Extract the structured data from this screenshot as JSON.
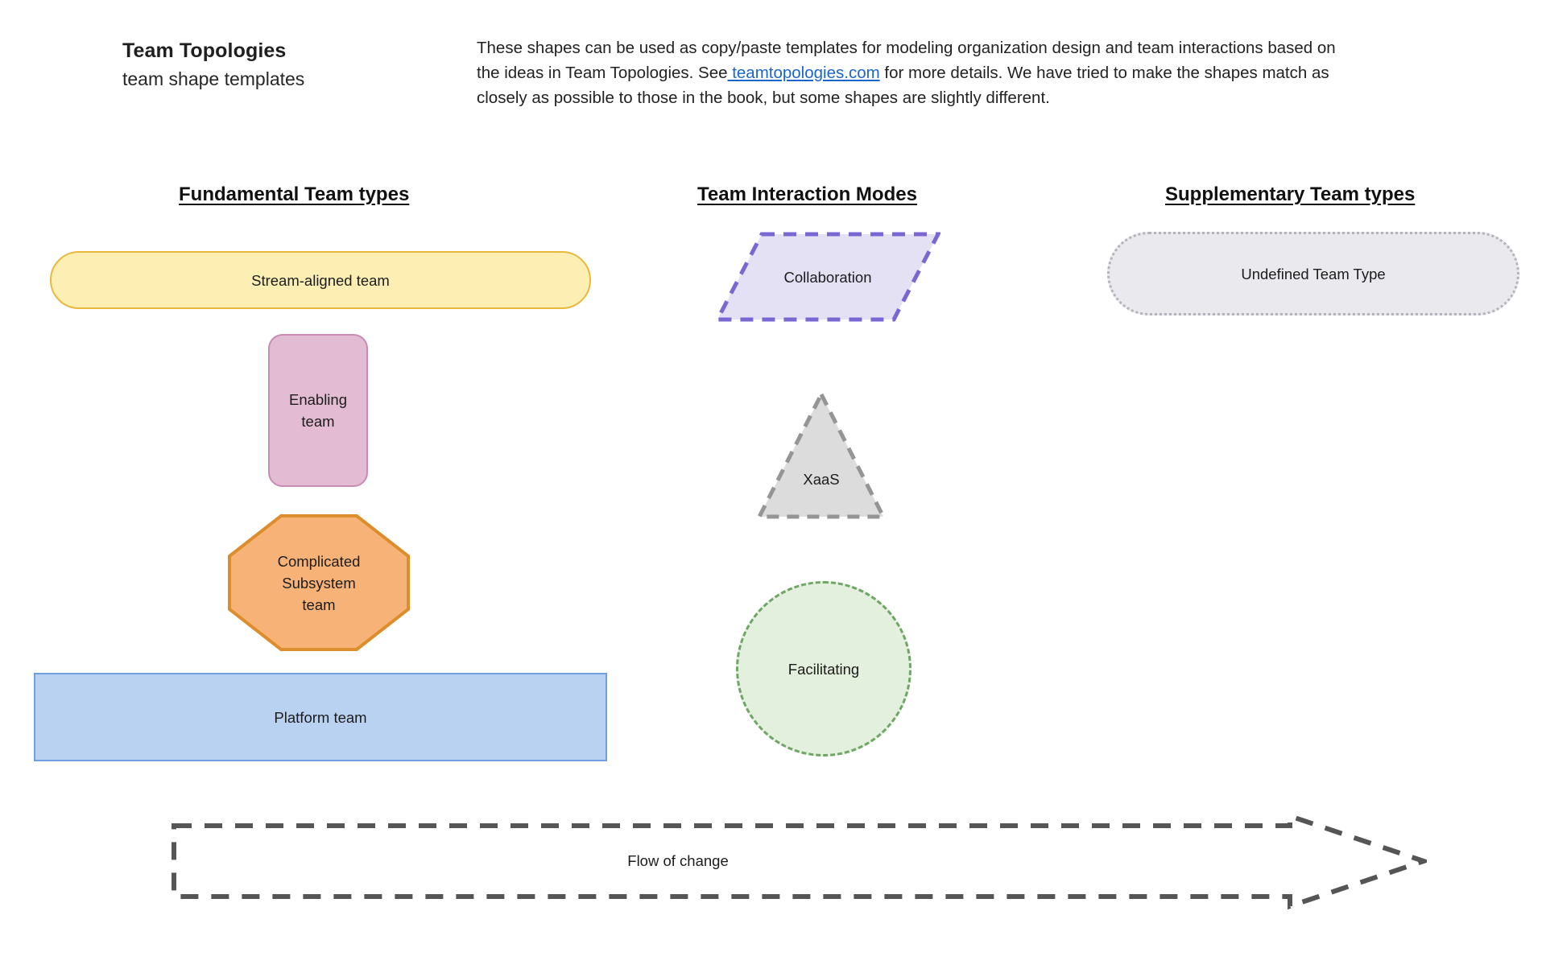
{
  "header": {
    "title": "Team Topologies",
    "subtitle": "team shape templates",
    "description_part1": "These shapes can be used as copy/paste templates for modeling organization design and team interactions based on the ideas in Team Topologies. See",
    "description_link": " teamtopologies.com",
    "description_part2": " for more details. We have tried to make the shapes match as closely as possible to those in the book, but some shapes are slightly different."
  },
  "columns": {
    "fundamental": "Fundamental Team types",
    "interaction": "Team Interaction Modes",
    "supplementary": "Supplementary Team types"
  },
  "shapes": {
    "stream_aligned": {
      "label": "Stream-aligned team",
      "fill": "#fdeeb3",
      "stroke": "#e8b93b",
      "form": "rounded-rectangle"
    },
    "enabling": {
      "label": "Enabling\nteam",
      "fill": "#e3bcd4",
      "stroke": "#c98bb4",
      "form": "rounded-rectangle-tall"
    },
    "complicated_subsystem": {
      "label": "Complicated\nSubsystem\nteam",
      "fill": "#f7b377",
      "stroke": "#dd8d2c",
      "form": "octagon"
    },
    "platform": {
      "label": "Platform team",
      "fill": "#bad2f2",
      "stroke": "#6f9fe0",
      "form": "rectangle"
    },
    "collaboration": {
      "label": "Collaboration",
      "fill": "#e4e1f5",
      "stroke": "#7a67d4",
      "form": "parallelogram-dashed"
    },
    "xaas": {
      "label": "XaaS",
      "fill": "#dcdcdc",
      "stroke": "#959595",
      "form": "triangle-dashed"
    },
    "facilitating": {
      "label": "Facilitating",
      "fill": "#e2f0dd",
      "stroke": "#6fa565",
      "form": "circle-dashed"
    },
    "undefined_team_type": {
      "label": "Undefined Team Type",
      "fill": "#e9e9ee",
      "stroke": "#b3b3bb",
      "form": "stadium-dotted"
    },
    "flow_of_change": {
      "label": "Flow of change",
      "fill": "#ffffff",
      "stroke": "#555555",
      "form": "arrow-dashed"
    }
  },
  "colors": {
    "link": "#1a66d0",
    "text": "#1a1a1a",
    "background": "#ffffff"
  }
}
